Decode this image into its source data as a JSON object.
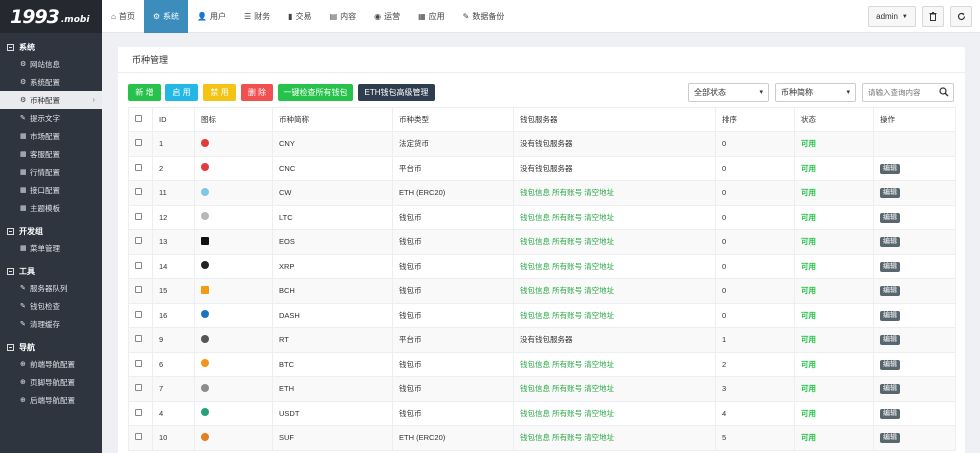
{
  "logo": {
    "main": "1993",
    "sub": ".mobi"
  },
  "sidebar": {
    "groups": [
      {
        "title": "系统",
        "items": [
          "网站信息",
          "系统配置",
          "币种配置",
          "提示文字",
          "市场配置",
          "客服配置",
          "行情配置",
          "接口配置",
          "主题模板"
        ]
      },
      {
        "title": "开发组",
        "items": [
          "菜单管理"
        ]
      },
      {
        "title": "工具",
        "items": [
          "服务器队列",
          "钱包检查",
          "清理缓存"
        ]
      },
      {
        "title": "导航",
        "items": [
          "前端导航配置",
          "页脚导航配置",
          "后端导航配置"
        ]
      }
    ]
  },
  "nav": [
    "首页",
    "系统",
    "用户",
    "财务",
    "交易",
    "内容",
    "运营",
    "应用",
    "数据备份"
  ],
  "topright": {
    "admin": "admin"
  },
  "panel": {
    "title": "币种管理",
    "buttons": {
      "new": "新 增",
      "enable": "启 用",
      "disable": "禁 用",
      "delete": "删 除",
      "check": "一键检查所有钱包",
      "eth": "ETH钱包高级管理"
    },
    "filters": {
      "status": "全部状态",
      "coin": "币种简称",
      "search_placeholder": "请输入查询内容"
    }
  },
  "table": {
    "headers": [
      "ID",
      "图标",
      "币种简称",
      "币种类型",
      "钱包服务器",
      "排序",
      "状态",
      "操作"
    ],
    "edit_label": "编辑",
    "wallet_links": {
      "info": "钱包信息",
      "accounts": "所有账号",
      "clear": "清空地址"
    },
    "rows": [
      {
        "id": "1",
        "name": "CNY",
        "type": "法定货币",
        "server": "没有钱包服务器",
        "sort": "0",
        "status": "可用",
        "edit": false,
        "icon_color": "#e23b3b"
      },
      {
        "id": "2",
        "name": "CNC",
        "type": "平台币",
        "server": "没有钱包服务器",
        "sort": "0",
        "status": "可用",
        "edit": true,
        "icon_color": "#e23b3b"
      },
      {
        "id": "11",
        "name": "CW",
        "type": "ETH (ERC20)",
        "server": "links",
        "sort": "0",
        "status": "可用",
        "edit": true,
        "icon_color": "#7fc8e8"
      },
      {
        "id": "12",
        "name": "LTC",
        "type": "钱包币",
        "server": "links",
        "sort": "0",
        "status": "可用",
        "edit": true,
        "icon_color": "#b8b8b8"
      },
      {
        "id": "13",
        "name": "EOS",
        "type": "钱包币",
        "server": "links",
        "sort": "0",
        "status": "可用",
        "edit": true,
        "icon_color": "#111111"
      },
      {
        "id": "14",
        "name": "XRP",
        "type": "钱包币",
        "server": "links",
        "sort": "0",
        "status": "可用",
        "edit": true,
        "icon_color": "#222222"
      },
      {
        "id": "15",
        "name": "BCH",
        "type": "钱包币",
        "server": "links",
        "sort": "0",
        "status": "可用",
        "edit": true,
        "icon_color": "#f39c12"
      },
      {
        "id": "16",
        "name": "DASH",
        "type": "钱包币",
        "server": "links",
        "sort": "0",
        "status": "可用",
        "edit": true,
        "icon_color": "#1c75bc"
      },
      {
        "id": "9",
        "name": "RT",
        "type": "平台币",
        "server": "没有钱包服务器",
        "sort": "1",
        "status": "可用",
        "edit": true,
        "icon_color": "#555555"
      },
      {
        "id": "6",
        "name": "BTC",
        "type": "钱包币",
        "server": "links",
        "sort": "2",
        "status": "可用",
        "edit": true,
        "icon_color": "#f7931a"
      },
      {
        "id": "7",
        "name": "ETH",
        "type": "钱包币",
        "server": "links",
        "sort": "3",
        "status": "可用",
        "edit": true,
        "icon_color": "#8c8c8c"
      },
      {
        "id": "4",
        "name": "USDT",
        "type": "钱包币",
        "server": "links",
        "sort": "4",
        "status": "可用",
        "edit": true,
        "icon_color": "#26a17b"
      },
      {
        "id": "10",
        "name": "SUF",
        "type": "ETH (ERC20)",
        "server": "links",
        "sort": "5",
        "status": "可用",
        "edit": true,
        "icon_color": "#e67e22"
      }
    ]
  }
}
